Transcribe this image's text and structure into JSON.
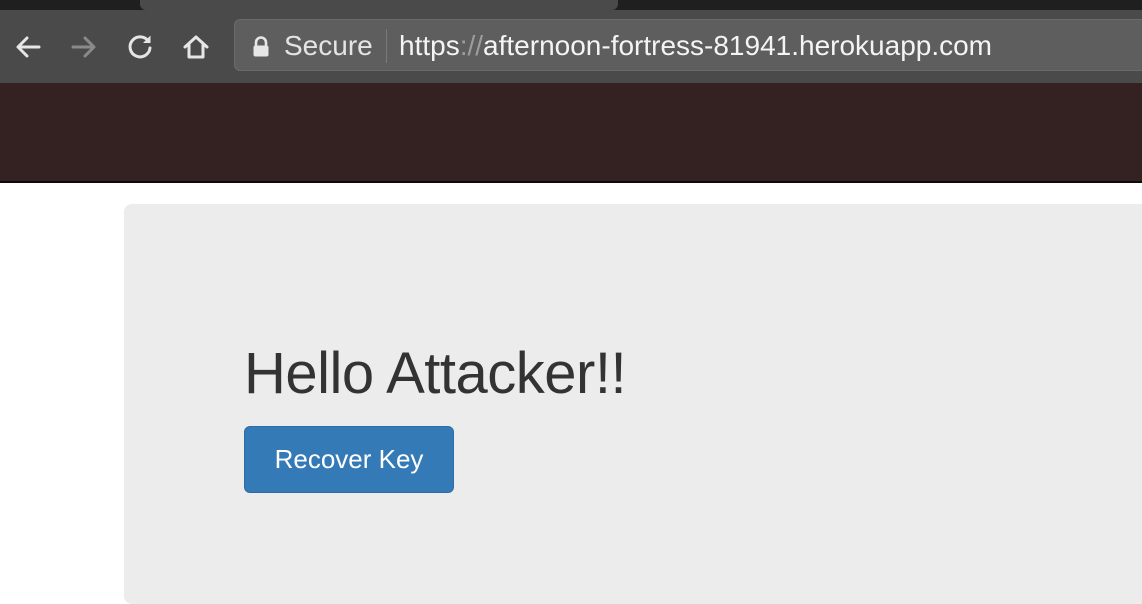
{
  "browser": {
    "security_label": "Secure",
    "url_scheme": "https",
    "url_separator": "://",
    "url_host": "afternoon-fortress-81941.herokuapp.com",
    "icons": {
      "back": "arrow-left-icon",
      "forward": "arrow-right-icon",
      "reload": "reload-icon",
      "home": "home-icon",
      "lock": "lock-icon"
    }
  },
  "page": {
    "heading": "Hello Attacker!!",
    "primary_button_label": "Recover Key"
  },
  "colors": {
    "navbar_background": "#342222",
    "jumbotron_background": "#ececec",
    "button_primary": "#337ab7",
    "heading_text": "#333333"
  }
}
